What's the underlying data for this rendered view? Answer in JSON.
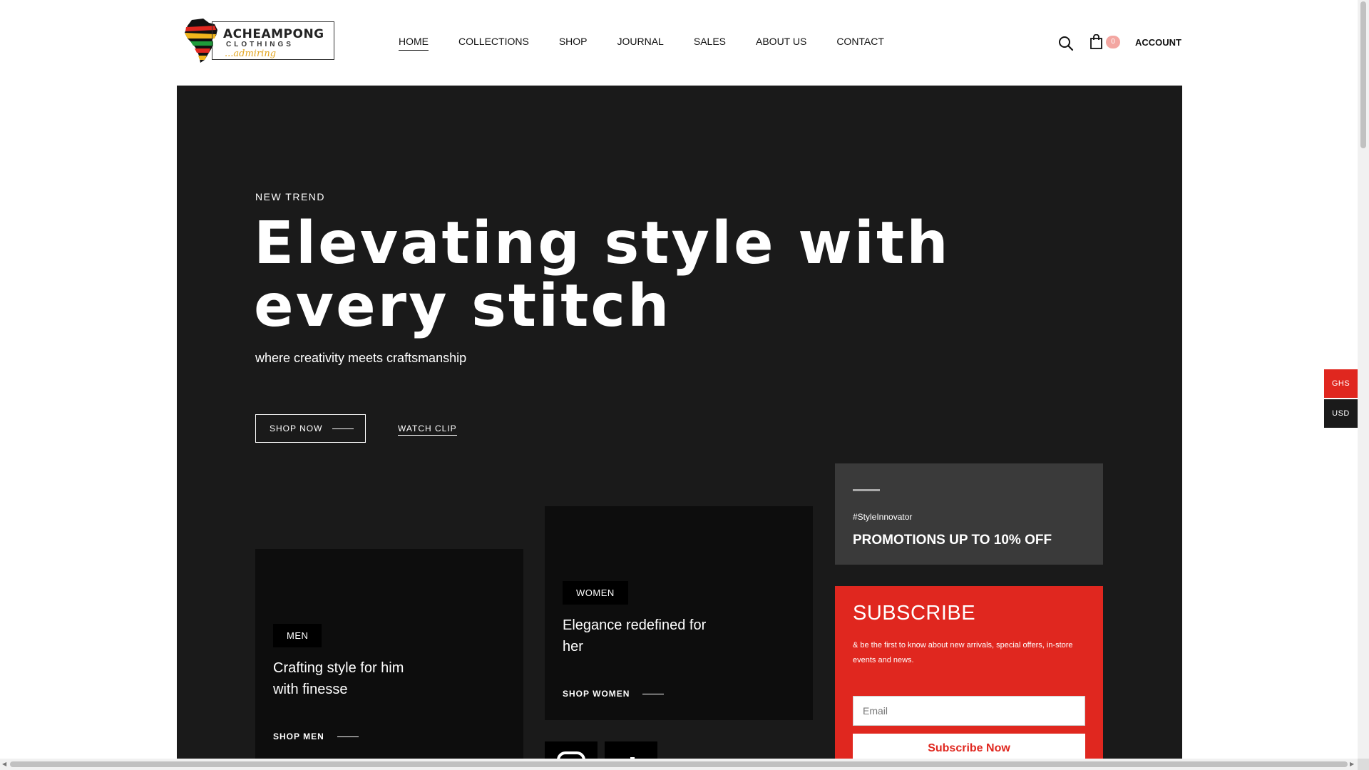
{
  "brand": {
    "name": "ACHEAMPONG",
    "sub": "CLOTHINGS",
    "tagline": "...admiring",
    "colors": [
      "#e0271f",
      "#f1b51c",
      "#1e9b3a",
      "#111111"
    ]
  },
  "nav": {
    "items": [
      {
        "label": "HOME",
        "active": true
      },
      {
        "label": "COLLECTIONS",
        "active": false
      },
      {
        "label": "SHOP",
        "active": false
      },
      {
        "label": "JOURNAL",
        "active": false
      },
      {
        "label": "SALES",
        "active": false
      },
      {
        "label": "ABOUT US",
        "active": false
      },
      {
        "label": "CONTACT",
        "active": false
      }
    ]
  },
  "header": {
    "search_icon": "search-icon",
    "cart_icon": "shopping-bag-icon",
    "cart_count": "0",
    "account_label": "ACCOUNT"
  },
  "hero": {
    "eyebrow": "NEW TREND",
    "headline": "Elevating style with every stitch",
    "subline": "where creativity meets craftsmanship",
    "shop_now_label": "SHOP NOW",
    "watch_clip_label": "WATCH CLIP"
  },
  "cards": {
    "men": {
      "badge": "MEN",
      "title": "Crafting style for him with finesse",
      "link": "SHOP MEN"
    },
    "women": {
      "badge": "WOMEN",
      "title": "Elegance redefined for her",
      "link": "SHOP WOMEN"
    }
  },
  "social": {
    "instagram_icon": "instagram-icon",
    "tiktok_icon": "tiktok-icon"
  },
  "promo": {
    "tag": "#StyleInnovator",
    "title": "PROMOTIONS UP TO 10% OFF"
  },
  "subscribe": {
    "title": "SUBSCRIBE",
    "text": "& be the first to know about new arrivals, special offers, in-store events and news.",
    "email_placeholder": "Email",
    "button_label": "Subscribe Now"
  },
  "currency": {
    "options": [
      "GHS",
      "USD"
    ],
    "selected": "GHS"
  },
  "theme": {
    "accent": "#e0271f",
    "dark": "#1a1a1a",
    "promo_bg": "#3a3a3a"
  }
}
